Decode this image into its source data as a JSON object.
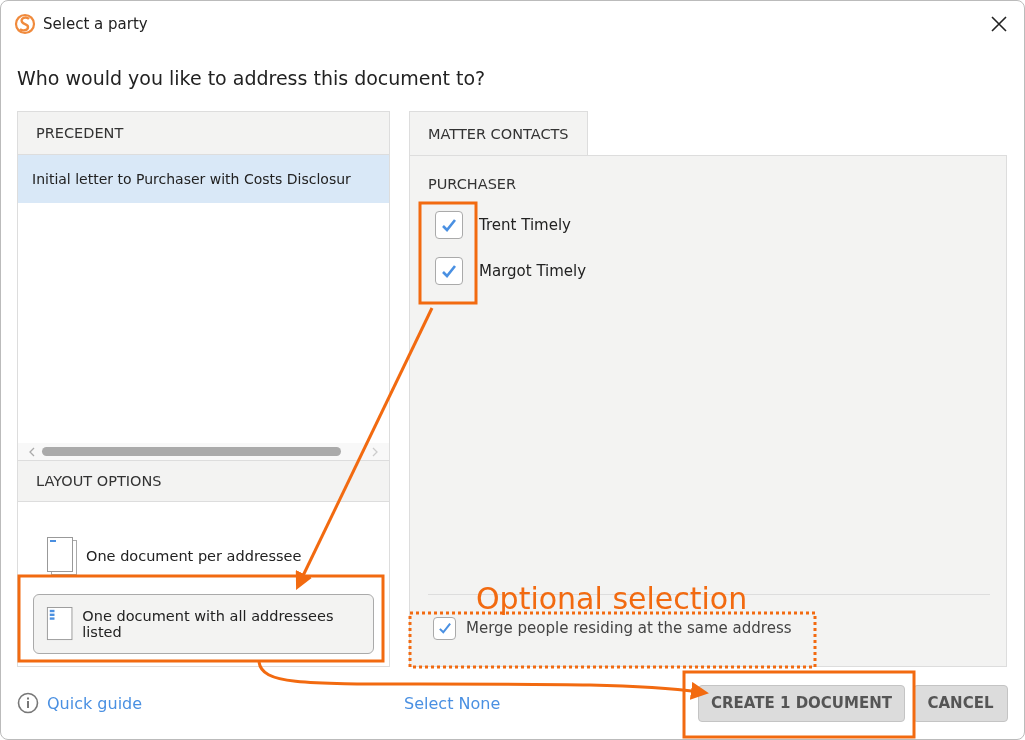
{
  "window": {
    "title": "Select a party"
  },
  "heading": "Who would you like to address this document to?",
  "precedent": {
    "header": "PRECEDENT",
    "items": [
      {
        "label": "Initial letter to Purchaser with Costs Disclosur",
        "selected": true
      }
    ]
  },
  "layout_options": {
    "header": "LAYOUT OPTIONS",
    "items": [
      {
        "label": "One document per addressee",
        "kind": "separate",
        "selected": false
      },
      {
        "label": "One document with all addressees listed",
        "kind": "combined",
        "selected": true
      }
    ]
  },
  "tabs": [
    {
      "label": "MATTER CONTACTS",
      "selected": true
    }
  ],
  "contact_groups": [
    {
      "name": "PURCHASER",
      "contacts": [
        {
          "name": "Trent Timely",
          "checked": true
        },
        {
          "name": "Margot Timely",
          "checked": true
        }
      ]
    }
  ],
  "merge_option": {
    "label": "Merge people residing at the same address",
    "checked": true
  },
  "footer": {
    "quick_guide": "Quick guide",
    "select_none": "Select None",
    "buttons": [
      {
        "label": "CREATE 1 DOCUMENT",
        "kind": "primary"
      },
      {
        "label": "CANCEL",
        "kind": "secondary"
      }
    ]
  },
  "annotations": [
    {
      "text": "Optional selection"
    }
  ]
}
